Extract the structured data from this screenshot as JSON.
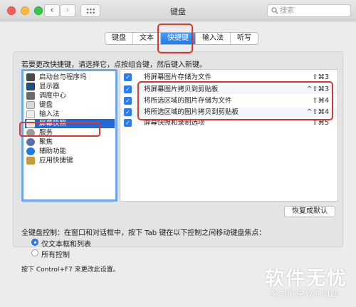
{
  "window": {
    "title": "键盘"
  },
  "search": {
    "placeholder": "搜索"
  },
  "tabs": [
    {
      "label": "键盘",
      "active": false
    },
    {
      "label": "文本",
      "active": false
    },
    {
      "label": "快捷键",
      "active": true
    },
    {
      "label": "输入法",
      "active": false
    },
    {
      "label": "听写",
      "active": false
    }
  ],
  "instruction": "若要更改快捷键，请选择它，点按组合键，然后键入新键。",
  "categories": [
    {
      "label": "启动台与程序坞",
      "icon": "dock-icon",
      "selected": false
    },
    {
      "label": "显示器",
      "icon": "display-icon",
      "selected": false
    },
    {
      "label": "调度中心",
      "icon": "mission-control-icon",
      "selected": false
    },
    {
      "label": "键盘",
      "icon": "keyboard-icon",
      "selected": false
    },
    {
      "label": "输入法",
      "icon": "input-method-icon",
      "selected": false
    },
    {
      "label": "屏幕快照",
      "icon": "screenshot-icon",
      "selected": true
    },
    {
      "label": "服务",
      "icon": "gear-icon",
      "selected": false
    },
    {
      "label": "聚焦",
      "icon": "spotlight-icon",
      "selected": false
    },
    {
      "label": "辅助功能",
      "icon": "accessibility-icon",
      "selected": false
    },
    {
      "label": "应用快捷键",
      "icon": "app-shortcuts-icon",
      "selected": false
    }
  ],
  "shortcuts": [
    {
      "label": "将屏幕图片存储为文件",
      "key": "⇧⌘3",
      "checked": true
    },
    {
      "label": "将屏幕图片拷贝到剪贴板",
      "key": "^⇧⌘3",
      "checked": true
    },
    {
      "label": "将所选区域的图片存储为文件",
      "key": "⇧⌘4",
      "checked": true
    },
    {
      "label": "将所选区域的图片拷贝到剪贴板",
      "key": "^⇧⌘4",
      "checked": true
    },
    {
      "label": "屏幕快照和录制选项",
      "key": "⇧⌘5",
      "checked": true
    }
  ],
  "restore_button": "恢复成默认",
  "keyboard_control": {
    "label": "全键盘控制：在窗口和对话框中，按下 Tab 键在以下控制之间移动键盘焦点：",
    "options": [
      {
        "label": "仅文本框和列表",
        "selected": true
      },
      {
        "label": "所有控制",
        "selected": false
      }
    ],
    "footnote": "按下 Control+F7 来更改此设置。"
  },
  "watermark": {
    "main": "软件无忧",
    "sub": "努力解决软件问题"
  }
}
